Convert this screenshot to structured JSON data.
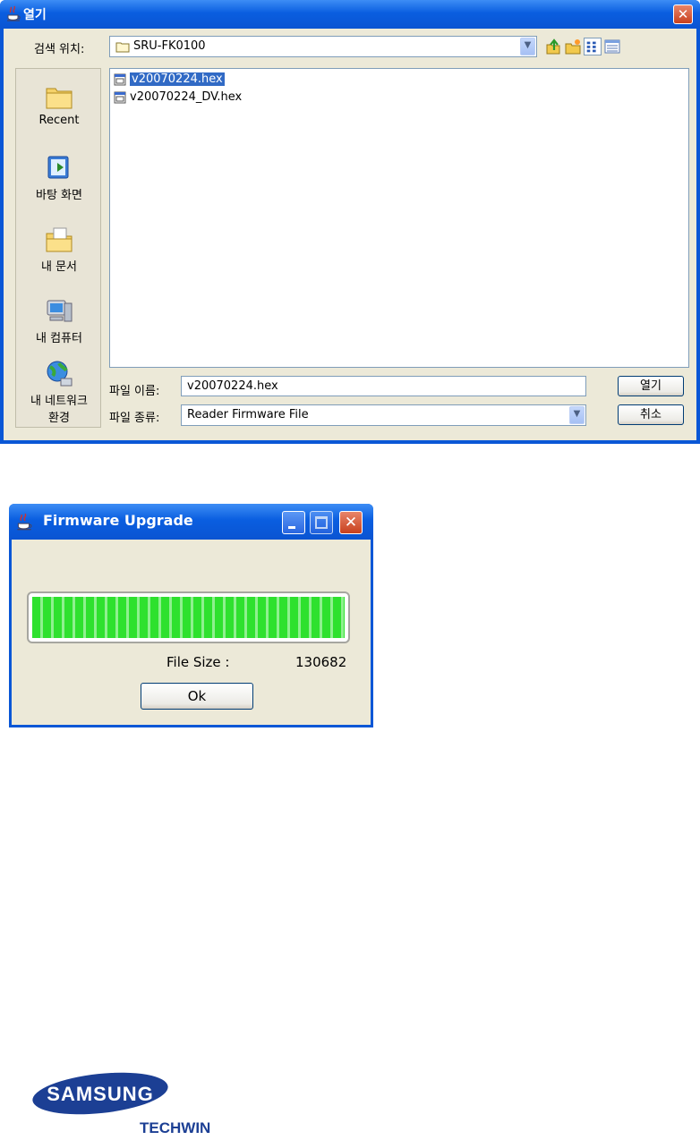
{
  "open_dialog": {
    "title": "열기",
    "look_in_label": "검색 위치:",
    "look_in_value": "SRU-FK0100",
    "places": [
      {
        "label": "Recent",
        "icon": "recent-folder-icon"
      },
      {
        "label": "바탕 화면",
        "icon": "desktop-icon"
      },
      {
        "label": "내 문서",
        "icon": "my-documents-icon"
      },
      {
        "label": "내 컴퓨터",
        "icon": "my-computer-icon"
      },
      {
        "label": "내 네트워크\n환경",
        "label_line1": "내 네트워크",
        "label_line2": "환경",
        "icon": "network-icon"
      }
    ],
    "files": [
      {
        "name": "v20070224.hex",
        "selected": true
      },
      {
        "name": "v20070224_DV.hex",
        "selected": false
      }
    ],
    "file_name_label": "파일 이름:",
    "file_name_value": "v20070224.hex",
    "file_type_label": "파일 종류:",
    "file_type_value": "Reader Firmware File",
    "open_button": "열기",
    "cancel_button": "취소"
  },
  "firmware_dialog": {
    "title": "Firmware Upgrade",
    "progress": 1.0,
    "file_size_label": "File Size :",
    "file_size_value": "130682",
    "ok_button": "Ok"
  },
  "logo": {
    "brand": "SAMSUNG",
    "sub": "TECHWIN",
    "colors": {
      "ellipse": "#1c3f94",
      "sub_text": "#1c3f94"
    }
  },
  "colors": {
    "titlebar": "#0a5ee0",
    "dialog_bg": "#ece9d8",
    "selection": "#316ac5",
    "progress_green": "#2ee12e"
  }
}
